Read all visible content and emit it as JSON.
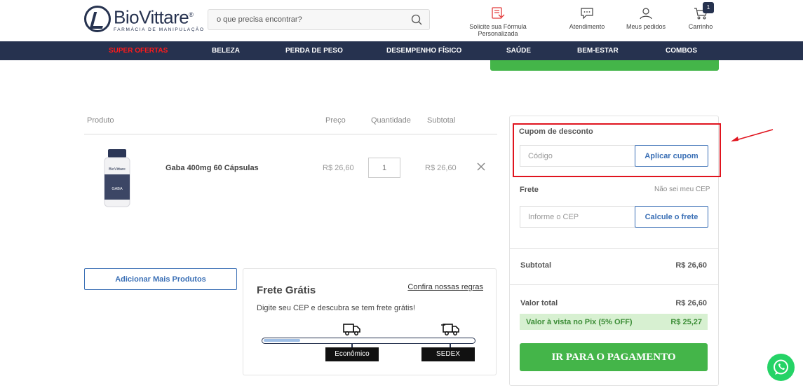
{
  "header": {
    "logo_name": "BioVittare",
    "logo_reg": "®",
    "logo_sub": "FARMÁCIA DE MANIPULAÇÃO",
    "search_placeholder": "o que precisa encontrar?",
    "formula_label": "Solicite sua Fórmula Personalizada",
    "support_label": "Atendimento",
    "orders_label": "Meus pedidos",
    "cart_label": "Carrinho",
    "cart_count": "1"
  },
  "nav": {
    "items": [
      "SUPER OFERTAS",
      "BELEZA",
      "PERDA DE PESO",
      "DESEMPENHO FÍSICO",
      "SAÚDE",
      "BEM-ESTAR",
      "COMBOS"
    ],
    "highlight_color": "#ff1a1a"
  },
  "cart_table": {
    "headers": {
      "product": "Produto",
      "price": "Preço",
      "quantity": "Quantidade",
      "subtotal": "Subtotal"
    },
    "rows": [
      {
        "name": "Gaba 400mg 60 Cápsulas",
        "price": "R$ 26,60",
        "quantity": "1",
        "subtotal": "R$ 26,60",
        "img_label": "GABA"
      }
    ]
  },
  "add_more_label": "Adicionar Mais Produtos",
  "free_shipping": {
    "title": "Frete Grátis",
    "rules_link": "Confira nossas regras",
    "description": "Digite seu CEP e descubra se tem frete grátis!",
    "progress": 0.17,
    "milestones": [
      "Econômico",
      "SEDEX"
    ]
  },
  "summary": {
    "coupon_label": "Cupom de desconto",
    "coupon_placeholder": "Código",
    "coupon_button": "Aplicar cupom",
    "shipping_label": "Frete",
    "no_cep_link": "Não sei meu CEP",
    "cep_placeholder": "Informe o CEP",
    "calc_button": "Calcule o frete",
    "subtotal_label": "Subtotal",
    "subtotal_value": "R$ 26,60",
    "total_label": "Valor total",
    "total_value": "R$ 26,60",
    "pix_label": "Valor à vista no Pix (5% OFF)",
    "pix_value": "R$ 25,27",
    "pay_button": "IR PARA O PAGAMENTO"
  },
  "colors": {
    "brand_navy": "#26324f",
    "accent_blue": "#3a6fb5",
    "green": "#44b549",
    "highlight_red": "#e0141e"
  }
}
